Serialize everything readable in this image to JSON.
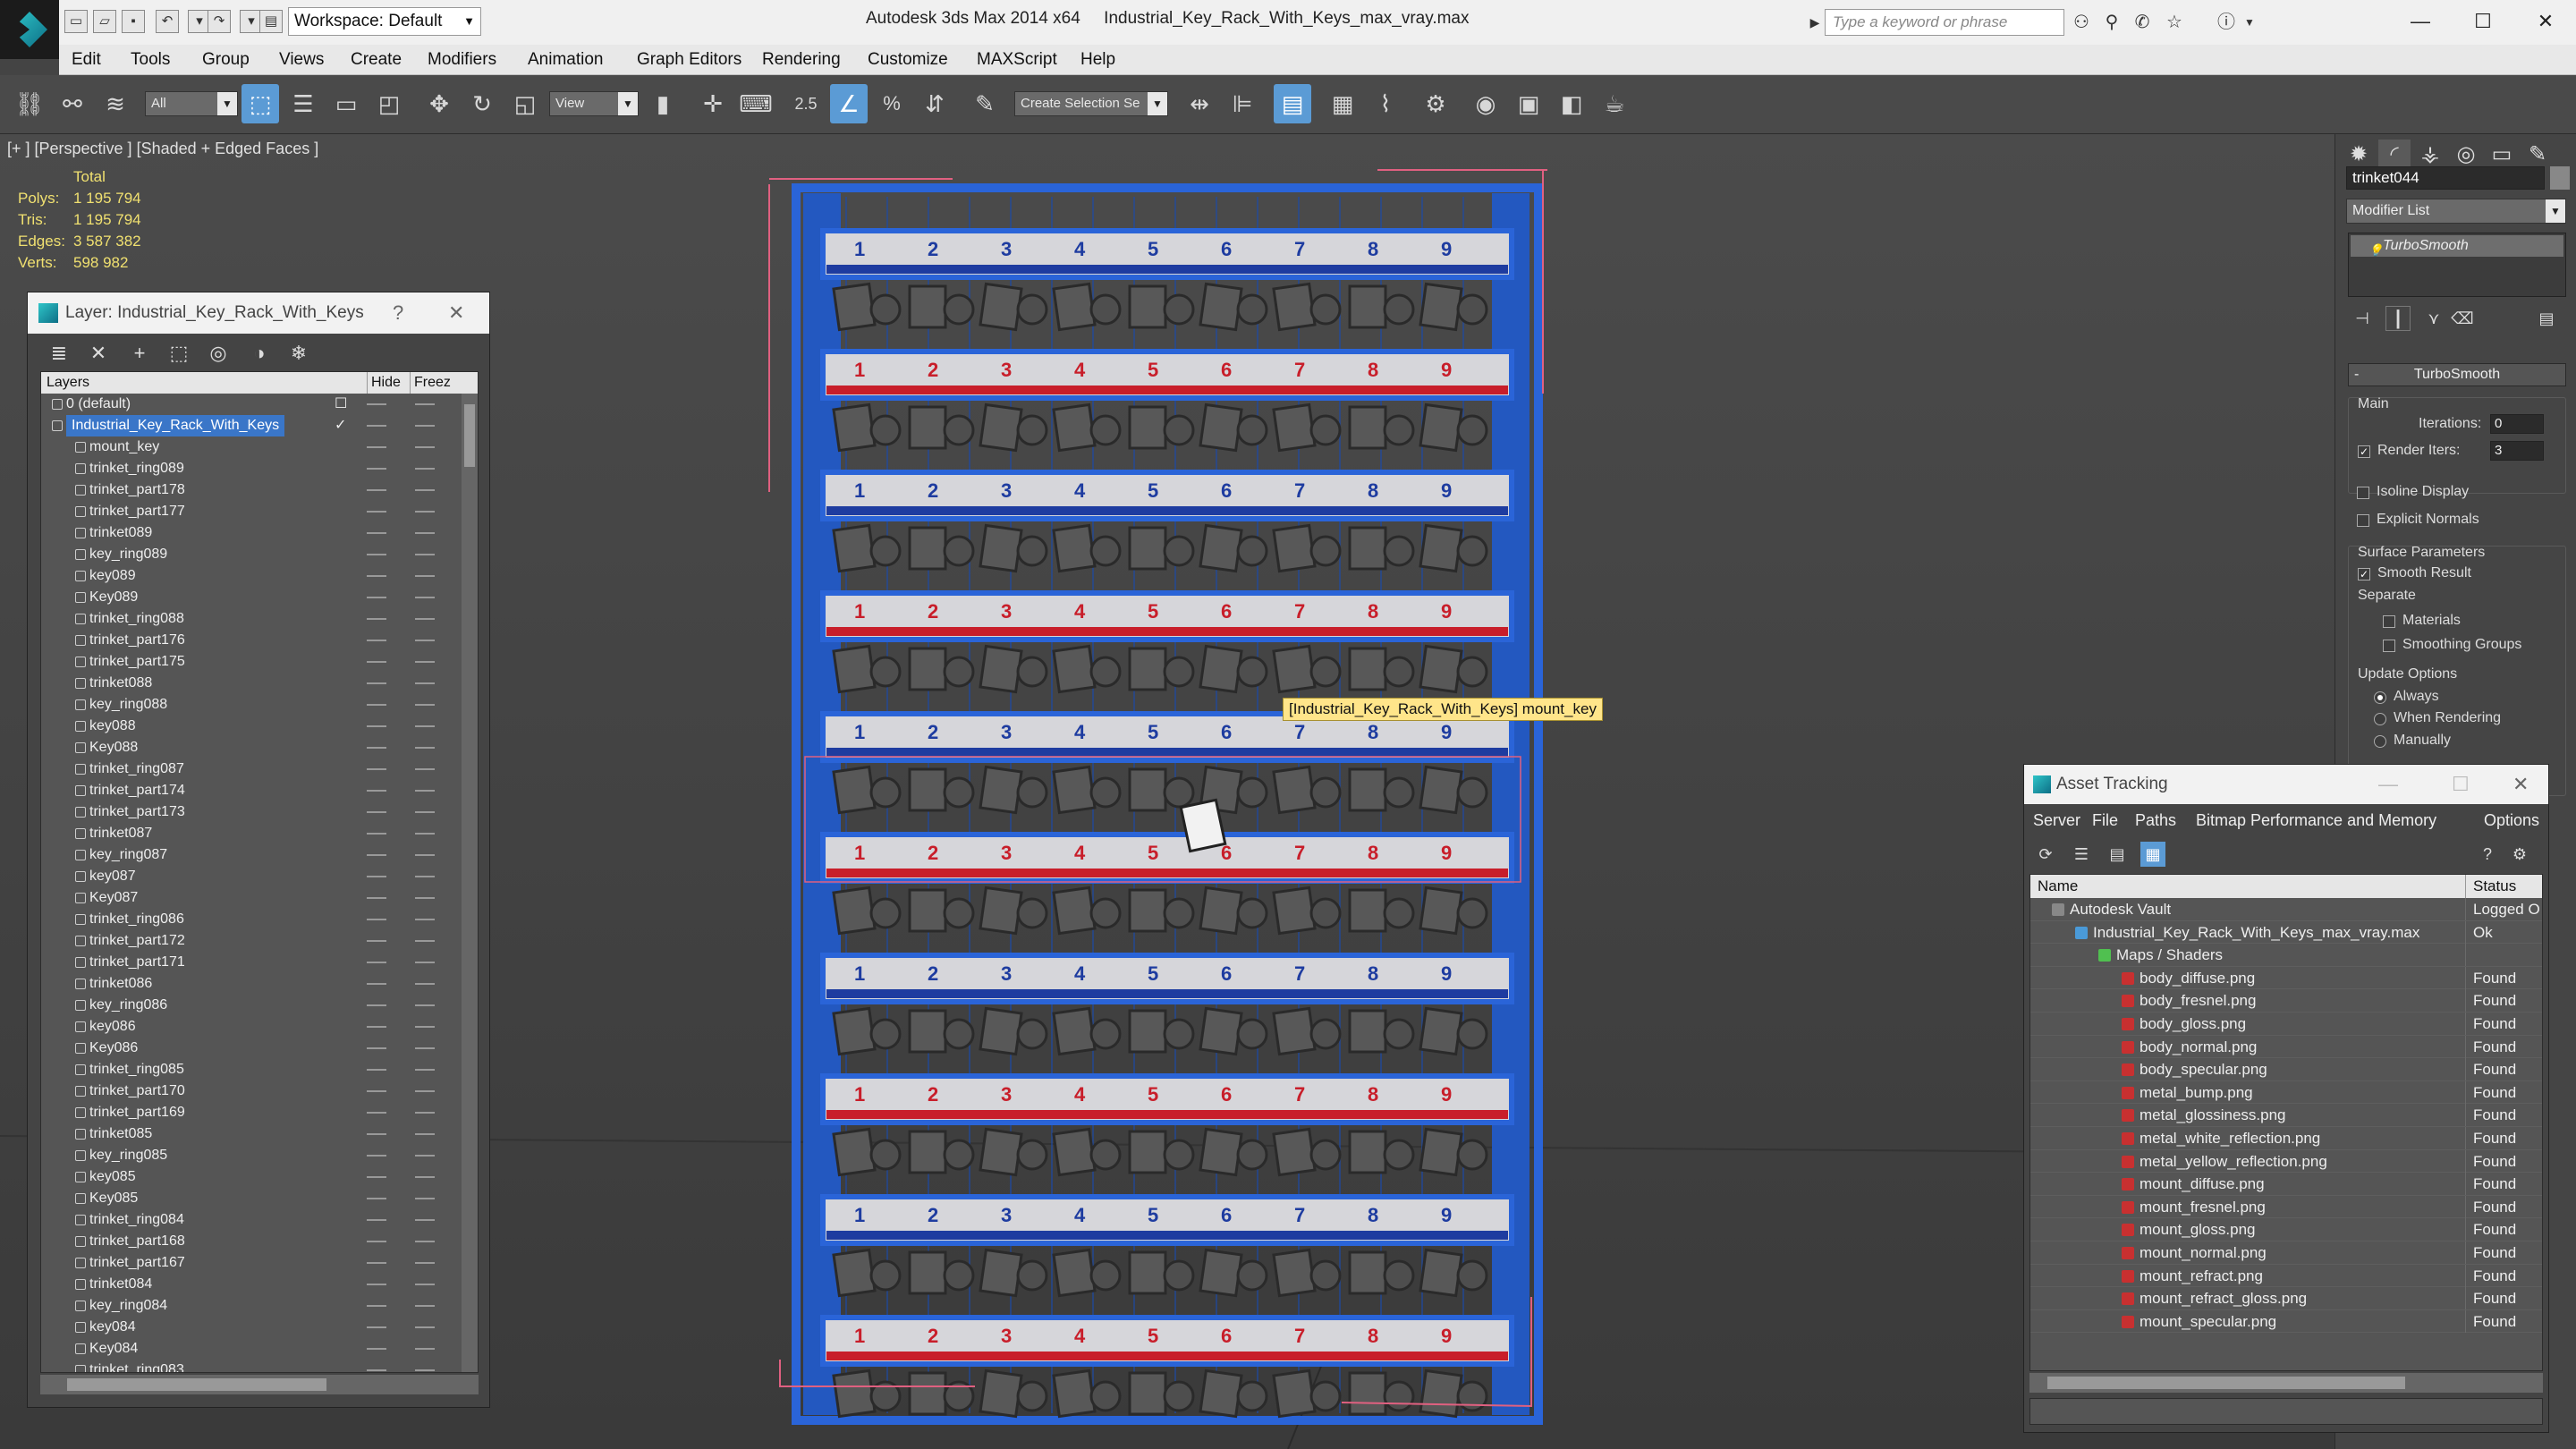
{
  "titlebar": {
    "workspace": "Workspace: Default",
    "app_title": "Autodesk 3ds Max  2014 x64",
    "file_title": "Industrial_Key_Rack_With_Keys_max_vray.max",
    "search_placeholder": "Type a keyword or phrase"
  },
  "menu": [
    "Edit",
    "Tools",
    "Group",
    "Views",
    "Create",
    "Modifiers",
    "Animation",
    "Graph Editors",
    "Rendering",
    "Customize",
    "MAXScript",
    "Help"
  ],
  "toolbar": {
    "selection_filter": "All",
    "ref_coord": "View",
    "snap_angle": "2.5",
    "named_selection": "Create Selection Se"
  },
  "viewport": {
    "label": "[+ ] [Perspective ] [Shaded + Edged Faces ]",
    "stats_header": "Total",
    "stats": [
      {
        "key": "Polys:",
        "value": "1 195 794"
      },
      {
        "key": "Tris:",
        "value": "1 195 794"
      },
      {
        "key": "Edges:",
        "value": "3 587 382"
      },
      {
        "key": "Verts:",
        "value": "598 982"
      }
    ],
    "tooltip": "[Industrial_Key_Rack_With_Keys] mount_key",
    "rack_numbers": [
      "1",
      "2",
      "3",
      "4",
      "5",
      "6",
      "7",
      "8",
      "9"
    ],
    "colors": {
      "wire": "#2a64d8",
      "red": "#c81e2a",
      "blue": "#1e3ca0",
      "yellow": "#ffe58a"
    }
  },
  "layer_window": {
    "title": "Layer: Industrial_Key_Rack_With_Keys",
    "help": "?",
    "close": "✕",
    "col_layers": "Layers",
    "col_hide": "Hide",
    "col_freeze": "Freez",
    "layers": [
      {
        "name": "0 (default)",
        "level": 0,
        "selected": false
      },
      {
        "name": "Industrial_Key_Rack_With_Keys",
        "level": 0,
        "selected": true
      },
      {
        "name": "mount_key",
        "level": 1
      },
      {
        "name": "trinket_ring089",
        "level": 1
      },
      {
        "name": "trinket_part178",
        "level": 1
      },
      {
        "name": "trinket_part177",
        "level": 1
      },
      {
        "name": "trinket089",
        "level": 1
      },
      {
        "name": "key_ring089",
        "level": 1
      },
      {
        "name": "key089",
        "level": 1
      },
      {
        "name": "Key089",
        "level": 1
      },
      {
        "name": "trinket_ring088",
        "level": 1
      },
      {
        "name": "trinket_part176",
        "level": 1
      },
      {
        "name": "trinket_part175",
        "level": 1
      },
      {
        "name": "trinket088",
        "level": 1
      },
      {
        "name": "key_ring088",
        "level": 1
      },
      {
        "name": "key088",
        "level": 1
      },
      {
        "name": "Key088",
        "level": 1
      },
      {
        "name": "trinket_ring087",
        "level": 1
      },
      {
        "name": "trinket_part174",
        "level": 1
      },
      {
        "name": "trinket_part173",
        "level": 1
      },
      {
        "name": "trinket087",
        "level": 1
      },
      {
        "name": "key_ring087",
        "level": 1
      },
      {
        "name": "key087",
        "level": 1
      },
      {
        "name": "Key087",
        "level": 1
      },
      {
        "name": "trinket_ring086",
        "level": 1
      },
      {
        "name": "trinket_part172",
        "level": 1
      },
      {
        "name": "trinket_part171",
        "level": 1
      },
      {
        "name": "trinket086",
        "level": 1
      },
      {
        "name": "key_ring086",
        "level": 1
      },
      {
        "name": "key086",
        "level": 1
      },
      {
        "name": "Key086",
        "level": 1
      },
      {
        "name": "trinket_ring085",
        "level": 1
      },
      {
        "name": "trinket_part170",
        "level": 1
      },
      {
        "name": "trinket_part169",
        "level": 1
      },
      {
        "name": "trinket085",
        "level": 1
      },
      {
        "name": "key_ring085",
        "level": 1
      },
      {
        "name": "key085",
        "level": 1
      },
      {
        "name": "Key085",
        "level": 1
      },
      {
        "name": "trinket_ring084",
        "level": 1
      },
      {
        "name": "trinket_part168",
        "level": 1
      },
      {
        "name": "trinket_part167",
        "level": 1
      },
      {
        "name": "trinket084",
        "level": 1
      },
      {
        "name": "key_ring084",
        "level": 1
      },
      {
        "name": "key084",
        "level": 1
      },
      {
        "name": "Key084",
        "level": 1
      },
      {
        "name": "trinket_ring083",
        "level": 1
      }
    ]
  },
  "command_panel": {
    "object_name": "trinket044",
    "modifier_list": "Modifier List",
    "stack_item": "TurboSmooth",
    "rollout_title": "TurboSmooth",
    "main_label": "Main",
    "iterations_label": "Iterations:",
    "iterations_value": "0",
    "render_iters_label": "Render Iters:",
    "render_iters_value": "3",
    "render_iters_checked": true,
    "isoline_label": "Isoline Display",
    "explicit_normals_label": "Explicit Normals",
    "surface_params_label": "Surface Parameters",
    "smooth_result_label": "Smooth Result",
    "separate_label": "Separate",
    "materials_label": "Materials",
    "smoothing_groups_label": "Smoothing Groups",
    "update_options_label": "Update Options",
    "always_label": "Always",
    "when_rendering_label": "When Rendering",
    "manually_label": "Manually"
  },
  "asset_window": {
    "title": "Asset Tracking",
    "menu": [
      "Server",
      "File",
      "Paths",
      "Bitmap Performance and Memory",
      "Options"
    ],
    "col_name": "Name",
    "col_status": "Status",
    "rows": [
      {
        "name": "Autodesk Vault",
        "status": "Logged O",
        "level": 0,
        "icon": "vault"
      },
      {
        "name": "Industrial_Key_Rack_With_Keys_max_vray.max",
        "status": "Ok",
        "level": 1,
        "icon": "max"
      },
      {
        "name": "Maps / Shaders",
        "status": "",
        "level": 2,
        "icon": "maps"
      },
      {
        "name": "body_diffuse.png",
        "status": "Found",
        "level": 3,
        "icon": "png"
      },
      {
        "name": "body_fresnel.png",
        "status": "Found",
        "level": 3,
        "icon": "png"
      },
      {
        "name": "body_gloss.png",
        "status": "Found",
        "level": 3,
        "icon": "png"
      },
      {
        "name": "body_normal.png",
        "status": "Found",
        "level": 3,
        "icon": "png"
      },
      {
        "name": "body_specular.png",
        "status": "Found",
        "level": 3,
        "icon": "png"
      },
      {
        "name": "metal_bump.png",
        "status": "Found",
        "level": 3,
        "icon": "png"
      },
      {
        "name": "metal_glossiness.png",
        "status": "Found",
        "level": 3,
        "icon": "png"
      },
      {
        "name": "metal_white_reflection.png",
        "status": "Found",
        "level": 3,
        "icon": "png"
      },
      {
        "name": "metal_yellow_reflection.png",
        "status": "Found",
        "level": 3,
        "icon": "png"
      },
      {
        "name": "mount_diffuse.png",
        "status": "Found",
        "level": 3,
        "icon": "png"
      },
      {
        "name": "mount_fresnel.png",
        "status": "Found",
        "level": 3,
        "icon": "png"
      },
      {
        "name": "mount_gloss.png",
        "status": "Found",
        "level": 3,
        "icon": "png"
      },
      {
        "name": "mount_normal.png",
        "status": "Found",
        "level": 3,
        "icon": "png"
      },
      {
        "name": "mount_refract.png",
        "status": "Found",
        "level": 3,
        "icon": "png"
      },
      {
        "name": "mount_refract_gloss.png",
        "status": "Found",
        "level": 3,
        "icon": "png"
      },
      {
        "name": "mount_specular.png",
        "status": "Found",
        "level": 3,
        "icon": "png"
      }
    ]
  }
}
